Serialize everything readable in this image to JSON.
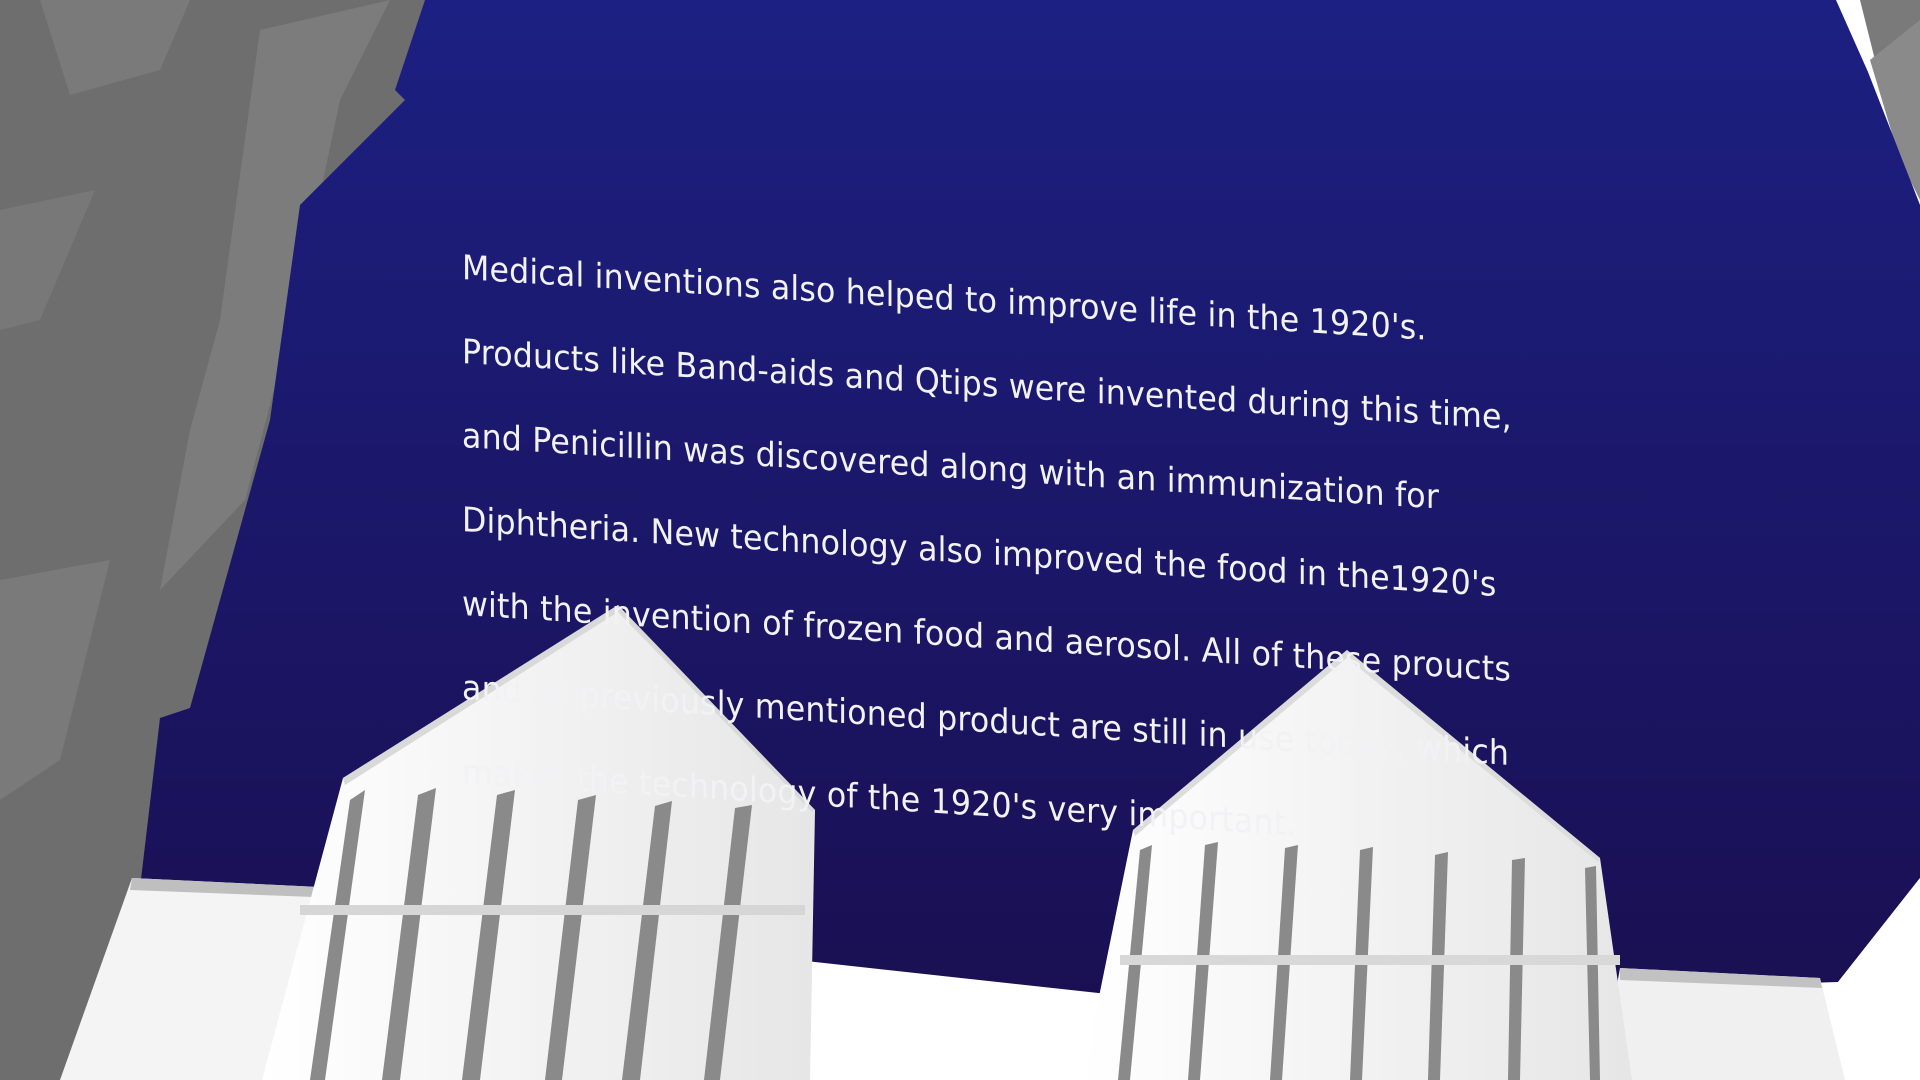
{
  "slide": {
    "lines": [
      "Medical inventions also helped to improve life in the 1920's.",
      "Products like Band-aids and Qtips were invented during this time,",
      "and Penicillin was discovered along with an immunization for",
      "Diphtheria.  New technology also improved the food in the1920's",
      "with the invention of frozen food and aerosol.  All of these proucts",
      "and all previously mentioned product are still in use today, which",
      "makes the technology of the 1920's very important."
    ]
  },
  "colors": {
    "panel_top": "#1c2082",
    "panel_bottom": "#1a0f52",
    "text": "#f2f2f5",
    "building_light": "#ffffff",
    "building_shadow": "#8a8a8a",
    "background_gray": "#6b6b6b"
  }
}
